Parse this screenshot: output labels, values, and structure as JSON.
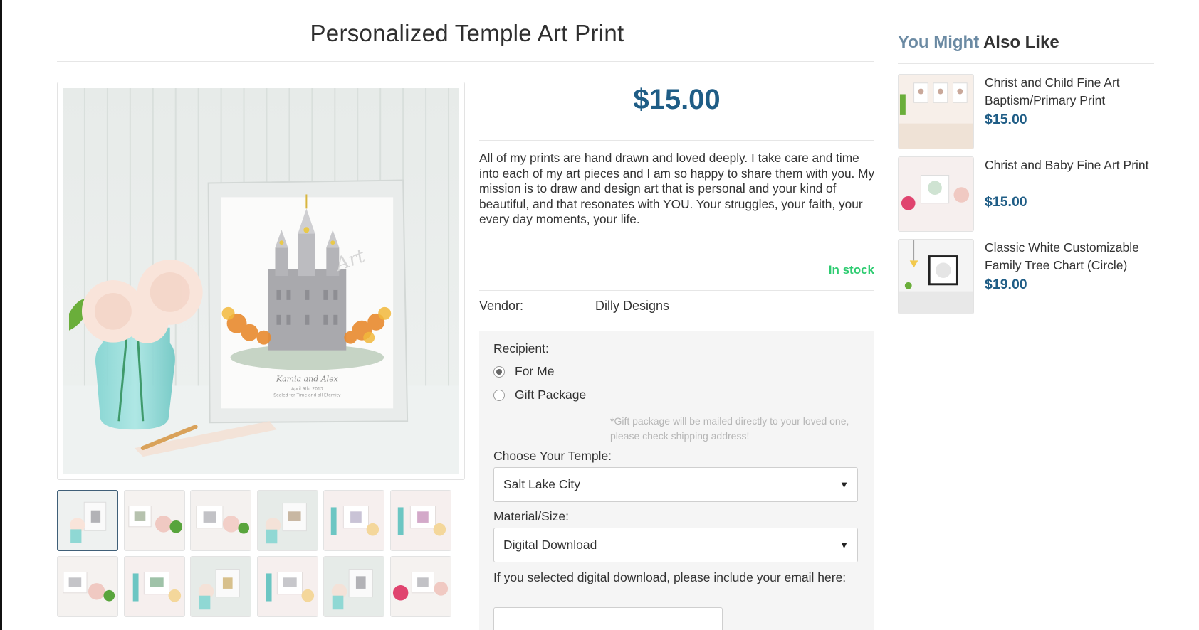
{
  "product": {
    "title": "Personalized Temple Art Print",
    "price": "$15.00",
    "description": "All of my prints are hand drawn and loved deeply. I take care and time into each of my art pieces and I am so happy to share them with you. My mission is to draw and design art that is personal and your kind of beautiful, and that resonates with YOU. Your struggles, your faith, your every day moments, your life.",
    "stock_status": "In stock",
    "vendor_label": "Vendor:",
    "vendor": "Dilly Designs",
    "image_artwork_text": {
      "names": "Kamia and Alex",
      "date": "April 9th, 2013",
      "caption": "Sealed for Time and all Eternity",
      "watermark": "Art"
    },
    "thumbnail_count": 12,
    "active_thumbnail": 1
  },
  "options": {
    "recipient_label": "Recipient:",
    "recipient_options": [
      "For Me",
      "Gift Package"
    ],
    "recipient_selected": "For Me",
    "gift_note": "*Gift package will be mailed directly to your loved one, please check shipping address!",
    "temple_label": "Choose Your Temple:",
    "temple_selected": "Salt Lake City",
    "material_label": "Material/Size:",
    "material_selected": "Digital Download",
    "email_note": "If you selected digital download, please include your email here:",
    "email_value": "",
    "caret": "▼"
  },
  "sidebar": {
    "title_part1": "You Might",
    "title_part2": "Also Like",
    "items": [
      {
        "name": "Christ and Child Fine Art Baptism/Primary Print",
        "price": "$15.00"
      },
      {
        "name": "Christ and Baby Fine Art Print",
        "price": "$15.00"
      },
      {
        "name": "Classic White Customizable Family Tree Chart (Circle)",
        "price": "$19.00"
      }
    ]
  },
  "colors": {
    "price": "#1f5d86",
    "in_stock": "#2ecc71",
    "sidebar_title_light": "#6b8aa3",
    "active_thumb_border": "#3f5f78"
  }
}
